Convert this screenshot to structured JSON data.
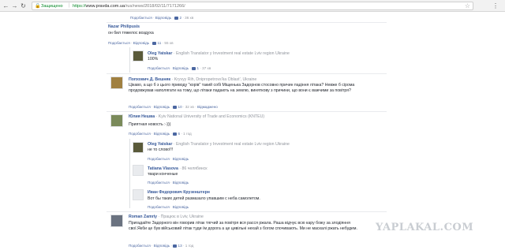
{
  "browser": {
    "secure_label": "Защищено",
    "url_scheme": "https://",
    "url_host": "www.pravda.com.ua",
    "url_path": "/rus/news/2018/02/11/7171266/"
  },
  "actions": {
    "like": "Подобається",
    "reply": "Відповідь",
    "hide": "Відмаджено"
  },
  "comments": [
    {
      "count": "2",
      "time": "36 хв"
    },
    {
      "name": "Nazar Philipusis",
      "meta": "",
      "text": "он бил тяжелос воздуха",
      "count": "11",
      "time": "55 хв"
    },
    {
      "name": "Oleg Yatskar",
      "meta": "· English Translator у Investment real estate Lviv region Ukraine",
      "text": "100%",
      "count": "1",
      "time": "37 хв"
    },
    {
      "name": "Попхович Д. Вешняк",
      "meta": "· Kryvyy Rih, Dnipropetrovs'ka Oblast', Ukraine",
      "text": "Цікаво, а що б з цього приводу \"корів\" такий собі Міщенька Задорнов стосовно причин падіння літака? Невже б сірома продовжував наполягати на тому, що літаки падають на землю, виняткову з причини, що вони є важчими за повітря?",
      "count": "10",
      "time": "32 хв"
    },
    {
      "name": "Юлия Нешва",
      "meta": "· Kyiv National University of Trade and Economics (KNTEU)",
      "text": "Приятная новость :-)))",
      "count": "6",
      "time": "1 год"
    },
    {
      "name": "Oleg Yatskar",
      "meta": "· English Translator у Investment real estate Lviv region Ukraine",
      "text": "не то слово!!!",
      "count": "",
      "time": ""
    },
    {
      "name": "Tatiana Vlasova",
      "meta": "· 86 челябинск",
      "text": "твари конченые",
      "count": "",
      "time": ""
    },
    {
      "name": "Иван Федорович Крузенштерн",
      "meta": "",
      "text": "Вот бы таких детей размазало упавшим с неба самолетом.",
      "count": "",
      "time": ""
    },
    {
      "name": "Roman Zamriy",
      "meta": "· Працює в Lviv, Ukraine",
      "text": "Пригадайте Задорного він говорив літак тягчий за повітря вся расся ржала. Раша відчує всю кару божу за злодіяння свої.Якби це був військовий літак туди їм дорога а це цивільні нехай з богом спочивають. Ми не маскалі ржать небудем.",
      "count": "13",
      "time": "1 год"
    }
  ],
  "watermark": "YAPLAKAL.COM"
}
